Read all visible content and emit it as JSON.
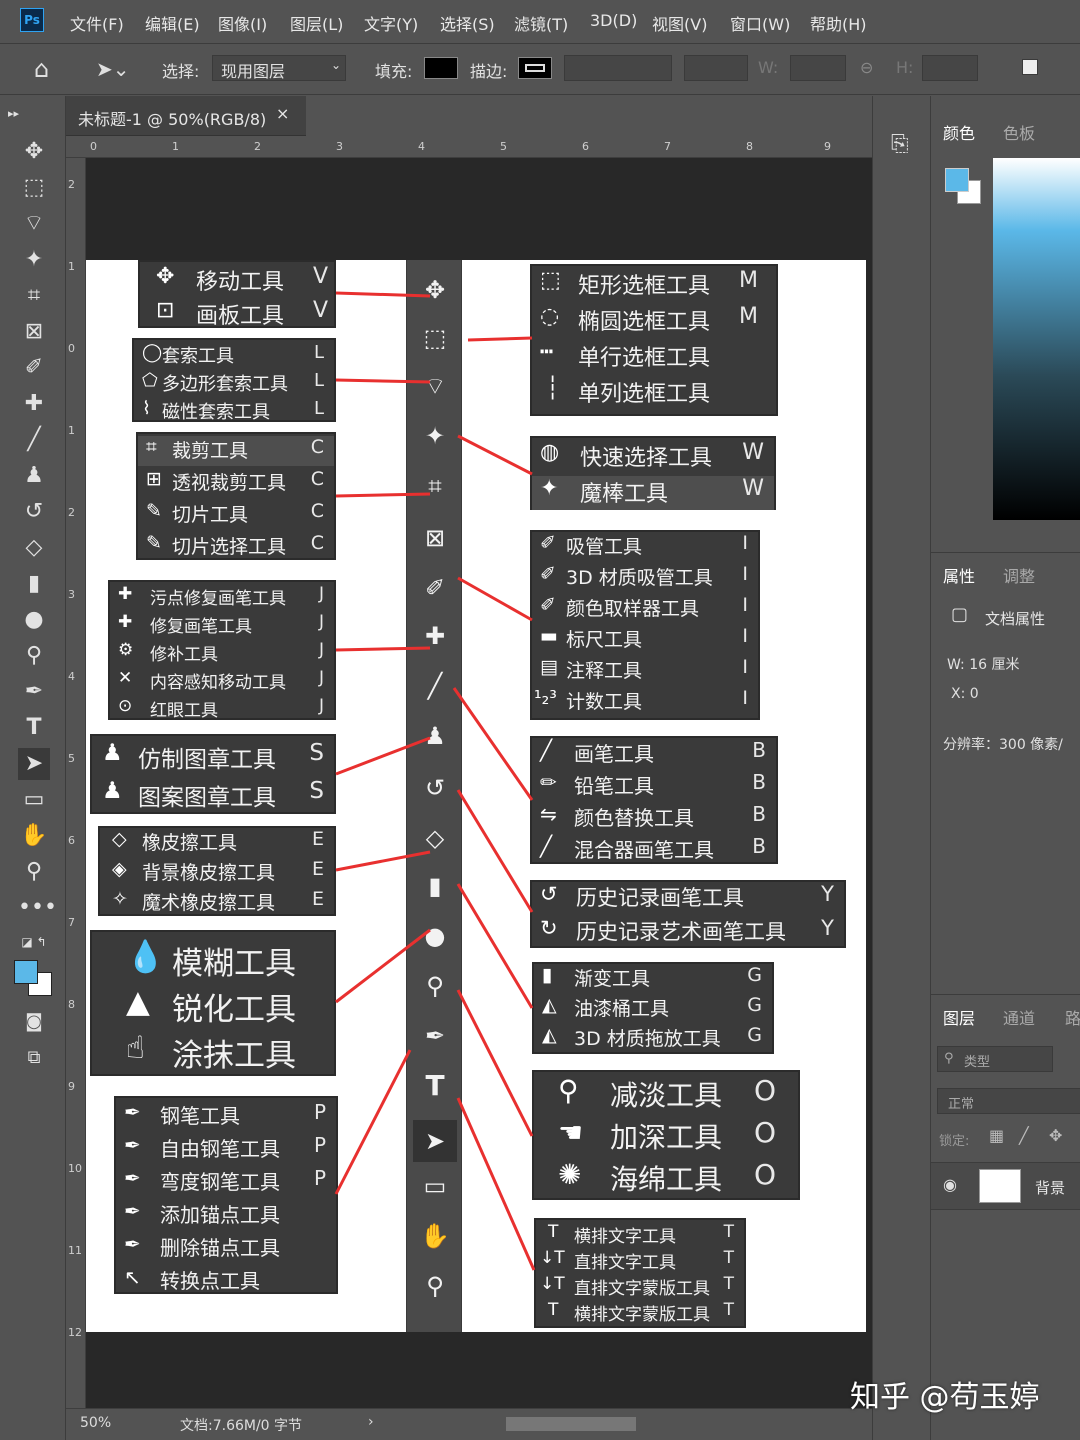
{
  "app": {
    "logo": "Ps"
  },
  "menu": [
    "文件(F)",
    "编辑(E)",
    "图像(I)",
    "图层(L)",
    "文字(Y)",
    "选择(S)",
    "滤镜(T)",
    "3D(D)",
    "视图(V)",
    "窗口(W)",
    "帮助(H)"
  ],
  "options": {
    "select_label": "选择:",
    "select_value": "现用图层",
    "fill_label": "填充:",
    "stroke_label": "描边:",
    "w_label": "W:",
    "h_label": "H:"
  },
  "document": {
    "tab_title": "未标题-1 @ 50%(RGB/8)",
    "close": "×",
    "zoom": "50%",
    "doc_size": "文档:7.66M/0 字节"
  },
  "ruler": {
    "h": [
      "0",
      "1",
      "2",
      "3",
      "4",
      "5",
      "6",
      "7",
      "8",
      "9"
    ],
    "v": [
      "2",
      "1",
      "0",
      "1",
      "2",
      "3",
      "4",
      "5",
      "6",
      "7",
      "8",
      "9",
      "10",
      "11",
      "12"
    ]
  },
  "callouts": {
    "move": [
      {
        "icon": "✥",
        "label": "移动工具",
        "key": "V"
      },
      {
        "icon": "⊡",
        "label": "画板工具",
        "key": "V"
      }
    ],
    "marquee": [
      {
        "icon": "⬚",
        "label": "矩形选框工具",
        "key": "M"
      },
      {
        "icon": "◌",
        "label": "椭圆选框工具",
        "key": "M"
      },
      {
        "icon": "┅",
        "label": "单行选框工具",
        "key": ""
      },
      {
        "icon": "┆",
        "label": "单列选框工具",
        "key": ""
      }
    ],
    "lasso": [
      {
        "icon": "◯",
        "label": "套索工具",
        "key": "L"
      },
      {
        "icon": "⬠",
        "label": "多边形套索工具",
        "key": "L"
      },
      {
        "icon": "⌇",
        "label": "磁性套索工具",
        "key": "L"
      }
    ],
    "quick_select": [
      {
        "icon": "◍",
        "label": "快速选择工具",
        "key": "W"
      },
      {
        "icon": "✦",
        "label": "魔棒工具",
        "key": "W"
      }
    ],
    "crop": [
      {
        "icon": "⌗",
        "label": "裁剪工具",
        "key": "C"
      },
      {
        "icon": "⊞",
        "label": "透视裁剪工具",
        "key": "C"
      },
      {
        "icon": "✎",
        "label": "切片工具",
        "key": "C"
      },
      {
        "icon": "✎",
        "label": "切片选择工具",
        "key": "C"
      }
    ],
    "eyedropper": [
      {
        "icon": "✐",
        "label": "吸管工具",
        "key": "I"
      },
      {
        "icon": "✐",
        "label": "3D 材质吸管工具",
        "key": "I"
      },
      {
        "icon": "✐",
        "label": "颜色取样器工具",
        "key": "I"
      },
      {
        "icon": "▬",
        "label": "标尺工具",
        "key": "I"
      },
      {
        "icon": "▤",
        "label": "注释工具",
        "key": "I"
      },
      {
        "icon": "¹₂³",
        "label": "计数工具",
        "key": "I"
      }
    ],
    "healing": [
      {
        "icon": "✚",
        "label": "污点修复画笔工具",
        "key": "J"
      },
      {
        "icon": "✚",
        "label": "修复画笔工具",
        "key": "J"
      },
      {
        "icon": "⚙",
        "label": "修补工具",
        "key": "J"
      },
      {
        "icon": "✕",
        "label": "内容感知移动工具",
        "key": "J"
      },
      {
        "icon": "⊙",
        "label": "红眼工具",
        "key": "J"
      }
    ],
    "brush": [
      {
        "icon": "╱",
        "label": "画笔工具",
        "key": "B"
      },
      {
        "icon": "✏",
        "label": "铅笔工具",
        "key": "B"
      },
      {
        "icon": "⇋",
        "label": "颜色替换工具",
        "key": "B"
      },
      {
        "icon": "╱",
        "label": "混合器画笔工具",
        "key": "B"
      }
    ],
    "stamp": [
      {
        "icon": "♟",
        "label": "仿制图章工具",
        "key": "S"
      },
      {
        "icon": "♟",
        "label": "图案图章工具",
        "key": "S"
      }
    ],
    "history": [
      {
        "icon": "↺",
        "label": "历史记录画笔工具",
        "key": "Y"
      },
      {
        "icon": "↻",
        "label": "历史记录艺术画笔工具",
        "key": "Y"
      }
    ],
    "eraser": [
      {
        "icon": "◇",
        "label": "橡皮擦工具",
        "key": "E"
      },
      {
        "icon": "◈",
        "label": "背景橡皮擦工具",
        "key": "E"
      },
      {
        "icon": "✧",
        "label": "魔术橡皮擦工具",
        "key": "E"
      }
    ],
    "gradient": [
      {
        "icon": "▮",
        "label": "渐变工具",
        "key": "G"
      },
      {
        "icon": "◭",
        "label": "油漆桶工具",
        "key": "G"
      },
      {
        "icon": "◭",
        "label": "3D 材质拖放工具",
        "key": "G"
      }
    ],
    "blur": [
      {
        "icon": "💧",
        "label": "模糊工具",
        "key": ""
      },
      {
        "icon": "▲",
        "label": "锐化工具",
        "key": ""
      },
      {
        "icon": "☝",
        "label": "涂抹工具",
        "key": ""
      }
    ],
    "dodge": [
      {
        "icon": "⚲",
        "label": "减淡工具",
        "key": "O"
      },
      {
        "icon": "☚",
        "label": "加深工具",
        "key": "O"
      },
      {
        "icon": "✺",
        "label": "海绵工具",
        "key": "O"
      }
    ],
    "pen": [
      {
        "icon": "✒",
        "label": "钢笔工具",
        "key": "P"
      },
      {
        "icon": "✒",
        "label": "自由钢笔工具",
        "key": "P"
      },
      {
        "icon": "✒",
        "label": "弯度钢笔工具",
        "key": "P"
      },
      {
        "icon": "✒",
        "label": "添加锚点工具",
        "key": ""
      },
      {
        "icon": "✒",
        "label": "删除锚点工具",
        "key": ""
      },
      {
        "icon": "↖",
        "label": "转换点工具",
        "key": ""
      }
    ],
    "type": [
      {
        "icon": "T",
        "label": "横排文字工具",
        "key": "T"
      },
      {
        "icon": "↓T",
        "label": "直排文字工具",
        "key": "T"
      },
      {
        "icon": "↓T",
        "label": "直排文字蒙版工具",
        "key": "T"
      },
      {
        "icon": "T",
        "label": "横排文字蒙版工具",
        "key": "T"
      }
    ]
  },
  "right_panel": {
    "color_tabs": [
      "颜色",
      "色板"
    ],
    "props_tabs": [
      "属性",
      "调整"
    ],
    "doc_props": "文档属性",
    "w_value": "W:  16 厘米",
    "x_value": "X:  0",
    "resolution": "分辨率：300 像素/",
    "layers_tabs": [
      "图层",
      "通道",
      "路"
    ],
    "kind": "类型",
    "blend": "正常",
    "lock": "锁定:",
    "layer_name": "背景"
  },
  "colors": {
    "fg": "#5bb8e8",
    "bg": "#ffffff",
    "accent": "#e8302f"
  },
  "watermark": "知乎 @苟玉婷"
}
